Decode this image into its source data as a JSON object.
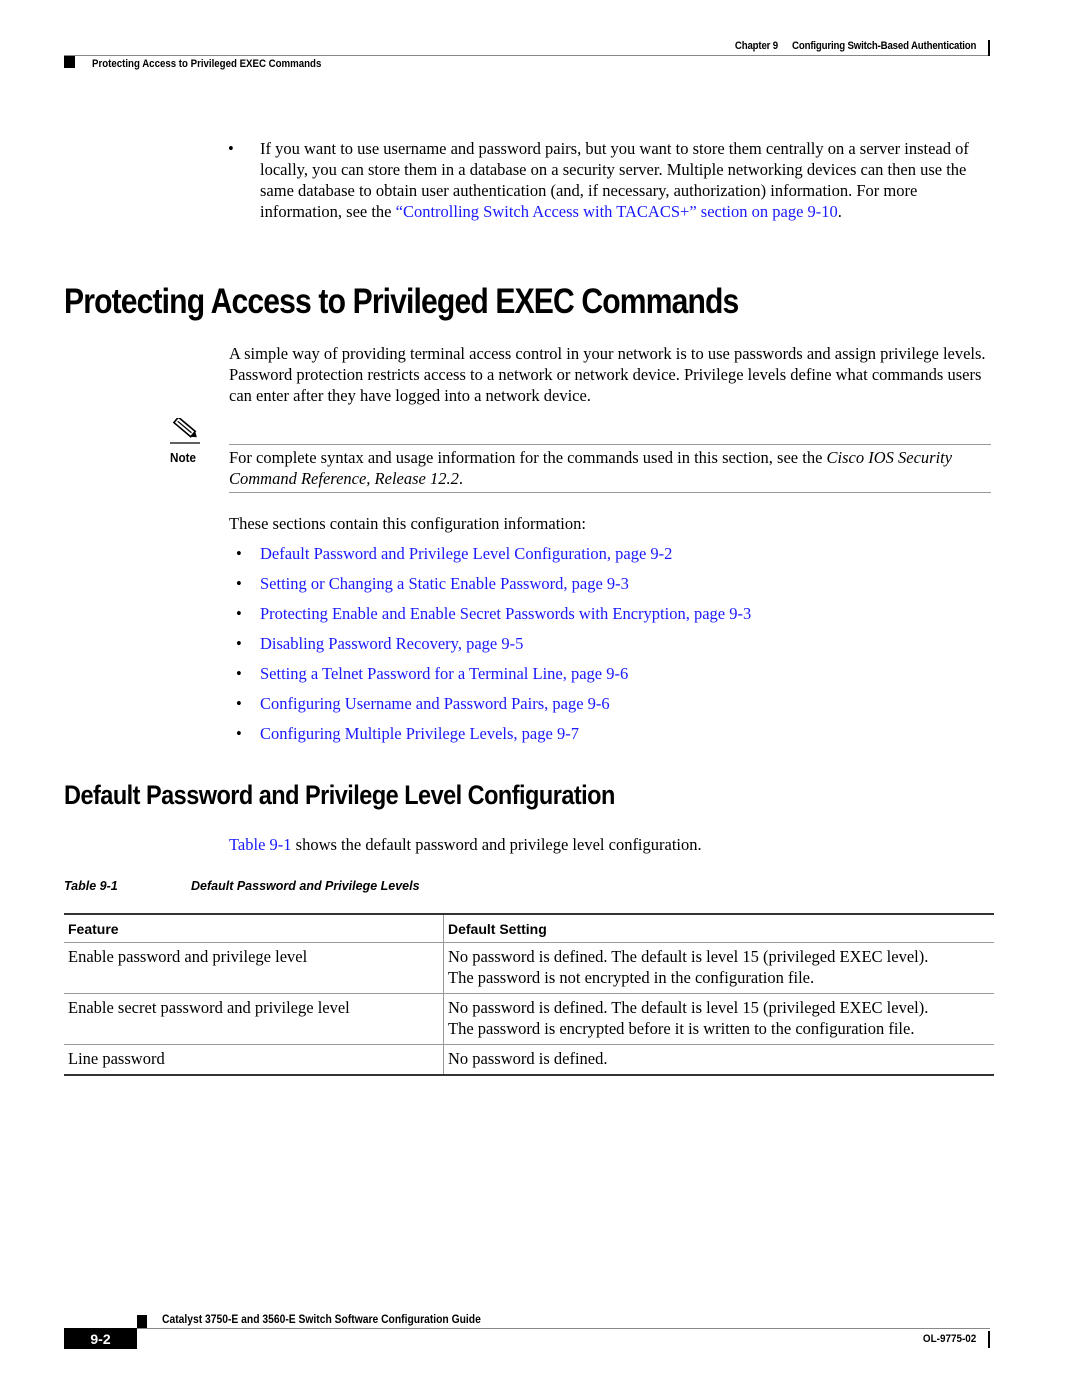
{
  "header": {
    "chapter_label": "Chapter 9",
    "chapter_title": "Configuring Switch-Based Authentication",
    "section_title": "Protecting Access to Privileged EXEC Commands"
  },
  "bullet_paragraph": {
    "text_before_link": "If you want to use username and password pairs, but you want to store them centrally on a server instead of locally, you can store them in a database on a security server. Multiple networking devices can then use the same database to obtain user authentication (and, if necessary, authorization) information. For more information, see the ",
    "link_text": "“Controlling Switch Access with TACACS+” section on page 9-10",
    "text_after_link": "."
  },
  "main_title": "Protecting Access to Privileged EXEC Commands",
  "intro_paragraph": "A simple way of providing terminal access control in your network is to use passwords and assign privilege levels. Password protection restricts access to a network or network device. Privilege levels define what commands users can enter after they have logged into a network device.",
  "note": {
    "label": "Note",
    "icon": "pencil-note-icon",
    "text_before": "For complete syntax and usage information for the commands used in this section, see the ",
    "italic_ref": "Cisco IOS Security Command Reference, Release 12.2",
    "text_after": "."
  },
  "sections_intro": "These sections contain this configuration information:",
  "toc_links": [
    "Default Password and Privilege Level Configuration, page 9-2",
    "Setting or Changing a Static Enable Password, page 9-3",
    "Protecting Enable and Enable Secret Passwords with Encryption, page 9-3",
    "Disabling Password Recovery, page 9-5",
    "Setting a Telnet Password for a Terminal Line, page 9-6",
    "Configuring Username and Password Pairs, page 9-6",
    "Configuring Multiple Privilege Levels, page 9-7"
  ],
  "subsection_title": "Default Password and Privilege Level Configuration",
  "table_reference": {
    "link_text": "Table 9-1",
    "text_after": " shows the default password and privilege level configuration."
  },
  "table": {
    "caption_number": "Table 9-1",
    "caption_title": "Default Password and Privilege Levels",
    "headers": [
      "Feature",
      "Default Setting"
    ],
    "rows": [
      {
        "feature": "Enable password and privilege level",
        "setting_lines": [
          "No password is defined. The default is level 15 (privileged EXEC level).",
          "The password is not encrypted in the configuration file."
        ]
      },
      {
        "feature": "Enable secret password and privilege level",
        "setting_lines": [
          "No password is defined. The default is level 15 (privileged EXEC level).",
          "The password is encrypted before it is written to the configuration file."
        ]
      },
      {
        "feature": "Line password",
        "setting_lines": [
          "No password is defined."
        ]
      }
    ]
  },
  "footer": {
    "guide_title": "Catalyst 3750-E and 3560-E Switch Software Configuration Guide",
    "page_number": "9-2",
    "doc_number": "OL-9775-02"
  },
  "colors": {
    "link": "#1a1aff",
    "text": "#000000",
    "rule": "#999999"
  }
}
